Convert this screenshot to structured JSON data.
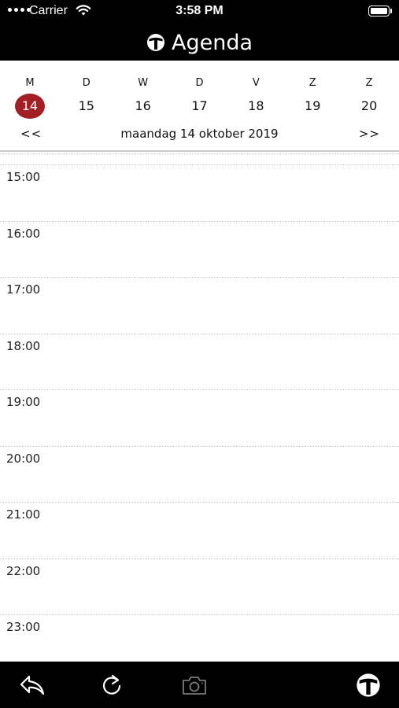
{
  "status_bar": {
    "carrier": "Carrier",
    "time": "3:58 PM",
    "icons": [
      "signal-dots-icon",
      "wifi-icon",
      "battery-icon"
    ]
  },
  "header": {
    "title": "Agenda",
    "logo_icon": "app-logo-icon"
  },
  "week": {
    "days": [
      {
        "letter": "M",
        "number": "14",
        "selected": true
      },
      {
        "letter": "D",
        "number": "15",
        "selected": false
      },
      {
        "letter": "W",
        "number": "16",
        "selected": false
      },
      {
        "letter": "D",
        "number": "17",
        "selected": false
      },
      {
        "letter": "V",
        "number": "18",
        "selected": false
      },
      {
        "letter": "Z",
        "number": "19",
        "selected": false
      },
      {
        "letter": "Z",
        "number": "20",
        "selected": false
      }
    ],
    "prev_label": "<<",
    "next_label": ">>",
    "date_label": "maandag 14 oktober 2019"
  },
  "hours": [
    "",
    "15:00",
    "16:00",
    "17:00",
    "18:00",
    "19:00",
    "20:00",
    "21:00",
    "22:00",
    "23:00"
  ],
  "toolbar": {
    "icons": [
      "back-arrow-icon",
      "refresh-icon",
      "camera-icon",
      "app-logo-icon"
    ]
  },
  "colors": {
    "accent": "#a31f24",
    "bar_background": "#000000",
    "separator": "#c8c8c8"
  }
}
